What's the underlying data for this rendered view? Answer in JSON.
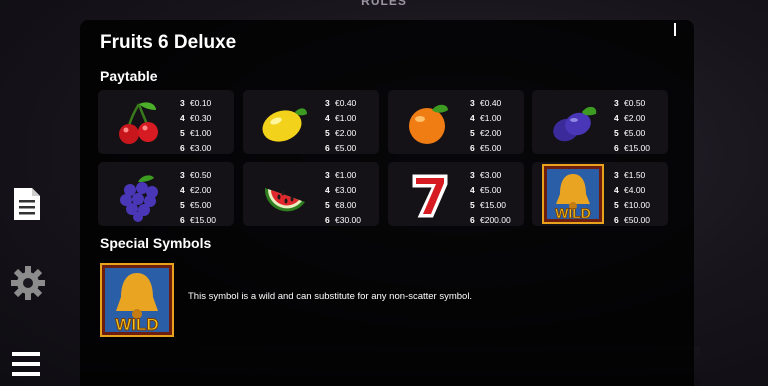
{
  "header": {
    "partial_text": "RULES"
  },
  "title": "Fruits 6 Deluxe",
  "paytable_heading": "Paytable",
  "symbols": [
    {
      "icon": "cherry-icon",
      "pays": [
        {
          "n": "3",
          "v": "€0.10"
        },
        {
          "n": "4",
          "v": "€0.30"
        },
        {
          "n": "5",
          "v": "€1.00"
        },
        {
          "n": "6",
          "v": "€3.00"
        }
      ]
    },
    {
      "icon": "lemon-icon",
      "pays": [
        {
          "n": "3",
          "v": "€0.40"
        },
        {
          "n": "4",
          "v": "€1.00"
        },
        {
          "n": "5",
          "v": "€2.00"
        },
        {
          "n": "6",
          "v": "€5.00"
        }
      ]
    },
    {
      "icon": "orange-icon",
      "pays": [
        {
          "n": "3",
          "v": "€0.40"
        },
        {
          "n": "4",
          "v": "€1.00"
        },
        {
          "n": "5",
          "v": "€2.00"
        },
        {
          "n": "6",
          "v": "€5.00"
        }
      ]
    },
    {
      "icon": "plum-icon",
      "pays": [
        {
          "n": "3",
          "v": "€0.50"
        },
        {
          "n": "4",
          "v": "€2.00"
        },
        {
          "n": "5",
          "v": "€5.00"
        },
        {
          "n": "6",
          "v": "€15.00"
        }
      ]
    },
    {
      "icon": "grapes-icon",
      "pays": [
        {
          "n": "3",
          "v": "€0.50"
        },
        {
          "n": "4",
          "v": "€2.00"
        },
        {
          "n": "5",
          "v": "€5.00"
        },
        {
          "n": "6",
          "v": "€15.00"
        }
      ]
    },
    {
      "icon": "watermelon-icon",
      "pays": [
        {
          "n": "3",
          "v": "€1.00"
        },
        {
          "n": "4",
          "v": "€3.00"
        },
        {
          "n": "5",
          "v": "€8.00"
        },
        {
          "n": "6",
          "v": "€30.00"
        }
      ]
    },
    {
      "icon": "seven-icon",
      "pays": [
        {
          "n": "3",
          "v": "€3.00"
        },
        {
          "n": "4",
          "v": "€5.00"
        },
        {
          "n": "5",
          "v": "€15.00"
        },
        {
          "n": "6",
          "v": "€200.00"
        }
      ]
    },
    {
      "icon": "bell-wild-icon",
      "wild_label": "WILD",
      "pays": [
        {
          "n": "3",
          "v": "€1.50"
        },
        {
          "n": "4",
          "v": "€4.00"
        },
        {
          "n": "5",
          "v": "€10.00"
        },
        {
          "n": "6",
          "v": "€50.00"
        }
      ]
    }
  ],
  "special_heading": "Special Symbols",
  "special": {
    "icon": "bell-wild-icon",
    "wild_label": "WILD",
    "description": "This symbol is a wild and can substitute for any non-scatter symbol."
  },
  "sidebar": {
    "icons": [
      "paytable-document-icon",
      "settings-gear-icon",
      "menu-hamburger-icon"
    ]
  },
  "colors": {
    "panel": "#000000",
    "card": "#141216",
    "wild_gold": "#e8a21c",
    "wild_text": "#f5c518"
  }
}
